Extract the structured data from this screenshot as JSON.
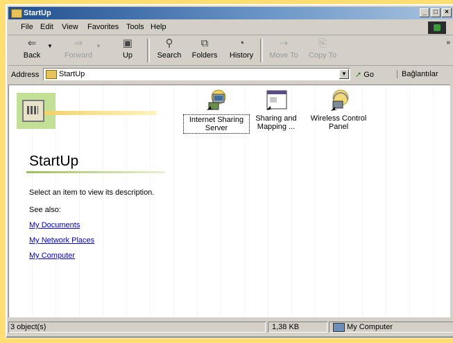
{
  "window": {
    "title": "StartUp"
  },
  "titlebar_buttons": {
    "minimize": "_",
    "maximize": "□",
    "close": "×"
  },
  "menu": [
    "File",
    "Edit",
    "View",
    "Favorites",
    "Tools",
    "Help"
  ],
  "toolbar": {
    "back": "Back",
    "forward": "Forward",
    "up": "Up",
    "search": "Search",
    "folders": "Folders",
    "history": "History",
    "move_to": "Move To",
    "copy_to": "Copy To"
  },
  "address": {
    "label": "Address",
    "value": "StartUp",
    "go": "Go",
    "links": "Bağlantılar"
  },
  "panel": {
    "heading": "StartUp",
    "description": "Select an item to view its description.",
    "see_also": "See also:",
    "links": [
      "My Documents",
      "My Network Places",
      "My Computer"
    ]
  },
  "items": [
    {
      "label": "Internet Sharing Server",
      "icon": "internet-sharing-server-icon"
    },
    {
      "label": "Sharing and Mapping ...",
      "icon": "sharing-mapping-icon"
    },
    {
      "label": "Wireless Control Panel",
      "icon": "wireless-control-panel-icon"
    }
  ],
  "status": {
    "objects": "3 object(s)",
    "size": "1,38 KB",
    "location": "My Computer"
  },
  "colors": {
    "title_bar": "#1f4f8f",
    "link": "#0000cc",
    "chrome": "#d4d0c8",
    "background": "#ffdf74"
  }
}
